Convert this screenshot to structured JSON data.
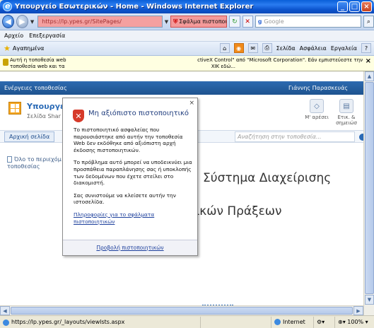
{
  "window": {
    "title": "Υπουργείο Εσωτερικών - Home - Windows Internet Explorer"
  },
  "address": {
    "url": "https://lp.ypes.gr/SitePages/",
    "cert_error_label": "Σφάλμα πιστοποιητ..."
  },
  "search": {
    "placeholder": "Google"
  },
  "menu": {
    "items": [
      "Αρχείο",
      "Επεξεργασία"
    ]
  },
  "commandbar": {
    "favorites_label": "Αγαπημένα",
    "page_label": "Σελίδα",
    "safety_label": "Ασφάλεια",
    "tools_label": "Εργαλεία"
  },
  "infobar": {
    "text_left": "Αυτή η τοποθεσία web",
    "text_left2": "τοποθεσία web και τα",
    "text_right": "ctiveX Control\" από \"Microsoft Corporation\". Εάν εμπιστεύεστε την",
    "text_right2": "ΧΙΚ εδώ..."
  },
  "sharepoint": {
    "site_actions": "Ενέργειες τοποθεσίας",
    "user": "Γιάννης Παρασκευάς",
    "site_title": "Υπουργεί",
    "site_subtitle": "Σελίδα Shar",
    "action_like": "Μ' αρέσει",
    "action_tags": "Ετικ. &",
    "action_tags2": "σημειώσ",
    "home_tab": "Αρχική σελίδα",
    "search_placeholder": "Αναζήτηση στην τοποθεσία...",
    "left_link1": "Όλο το περιεχόμ",
    "left_link2": "τοποθεσίας",
    "heading1": "Σύστημα Διαχείρισης",
    "heading2": "Ληξιαρχικών Πράξεων"
  },
  "popup": {
    "title": "Μη αξιόπιστο πιστοποιητικό",
    "p1": "Το πιστοποιητικό ασφαλείας που παρουσιάστηκε από αυτήν την τοποθεσία Web δεν εκδόθηκε από αξιόπιστη αρχή έκδοσης πιστοποιητικών.",
    "p2": "Το πρόβλημα αυτό μπορεί να υποδεικνύει μια προσπάθεια παραπλάνησης σας ή υποκλοπής των δεδομένων που έχετε στείλει στο διακομιστή.",
    "p3": "Σας συνιστούμε να κλείσετε αυτήν την ιστοσελίδα.",
    "link": "Πληροφορίες για το σφάλματα πιστοποιητικών",
    "footer": "Προβολή πιστοποιητικών",
    "close": "×"
  },
  "status": {
    "url": "https://lp.ypes.gr/_layouts/viewlsts.aspx",
    "zone": "Internet",
    "zoom": "100%"
  },
  "colors": {
    "address_error": "#f4a0a0",
    "sharepoint_bar": "#2d6ab0",
    "popup_title": "#1f3c7d"
  }
}
